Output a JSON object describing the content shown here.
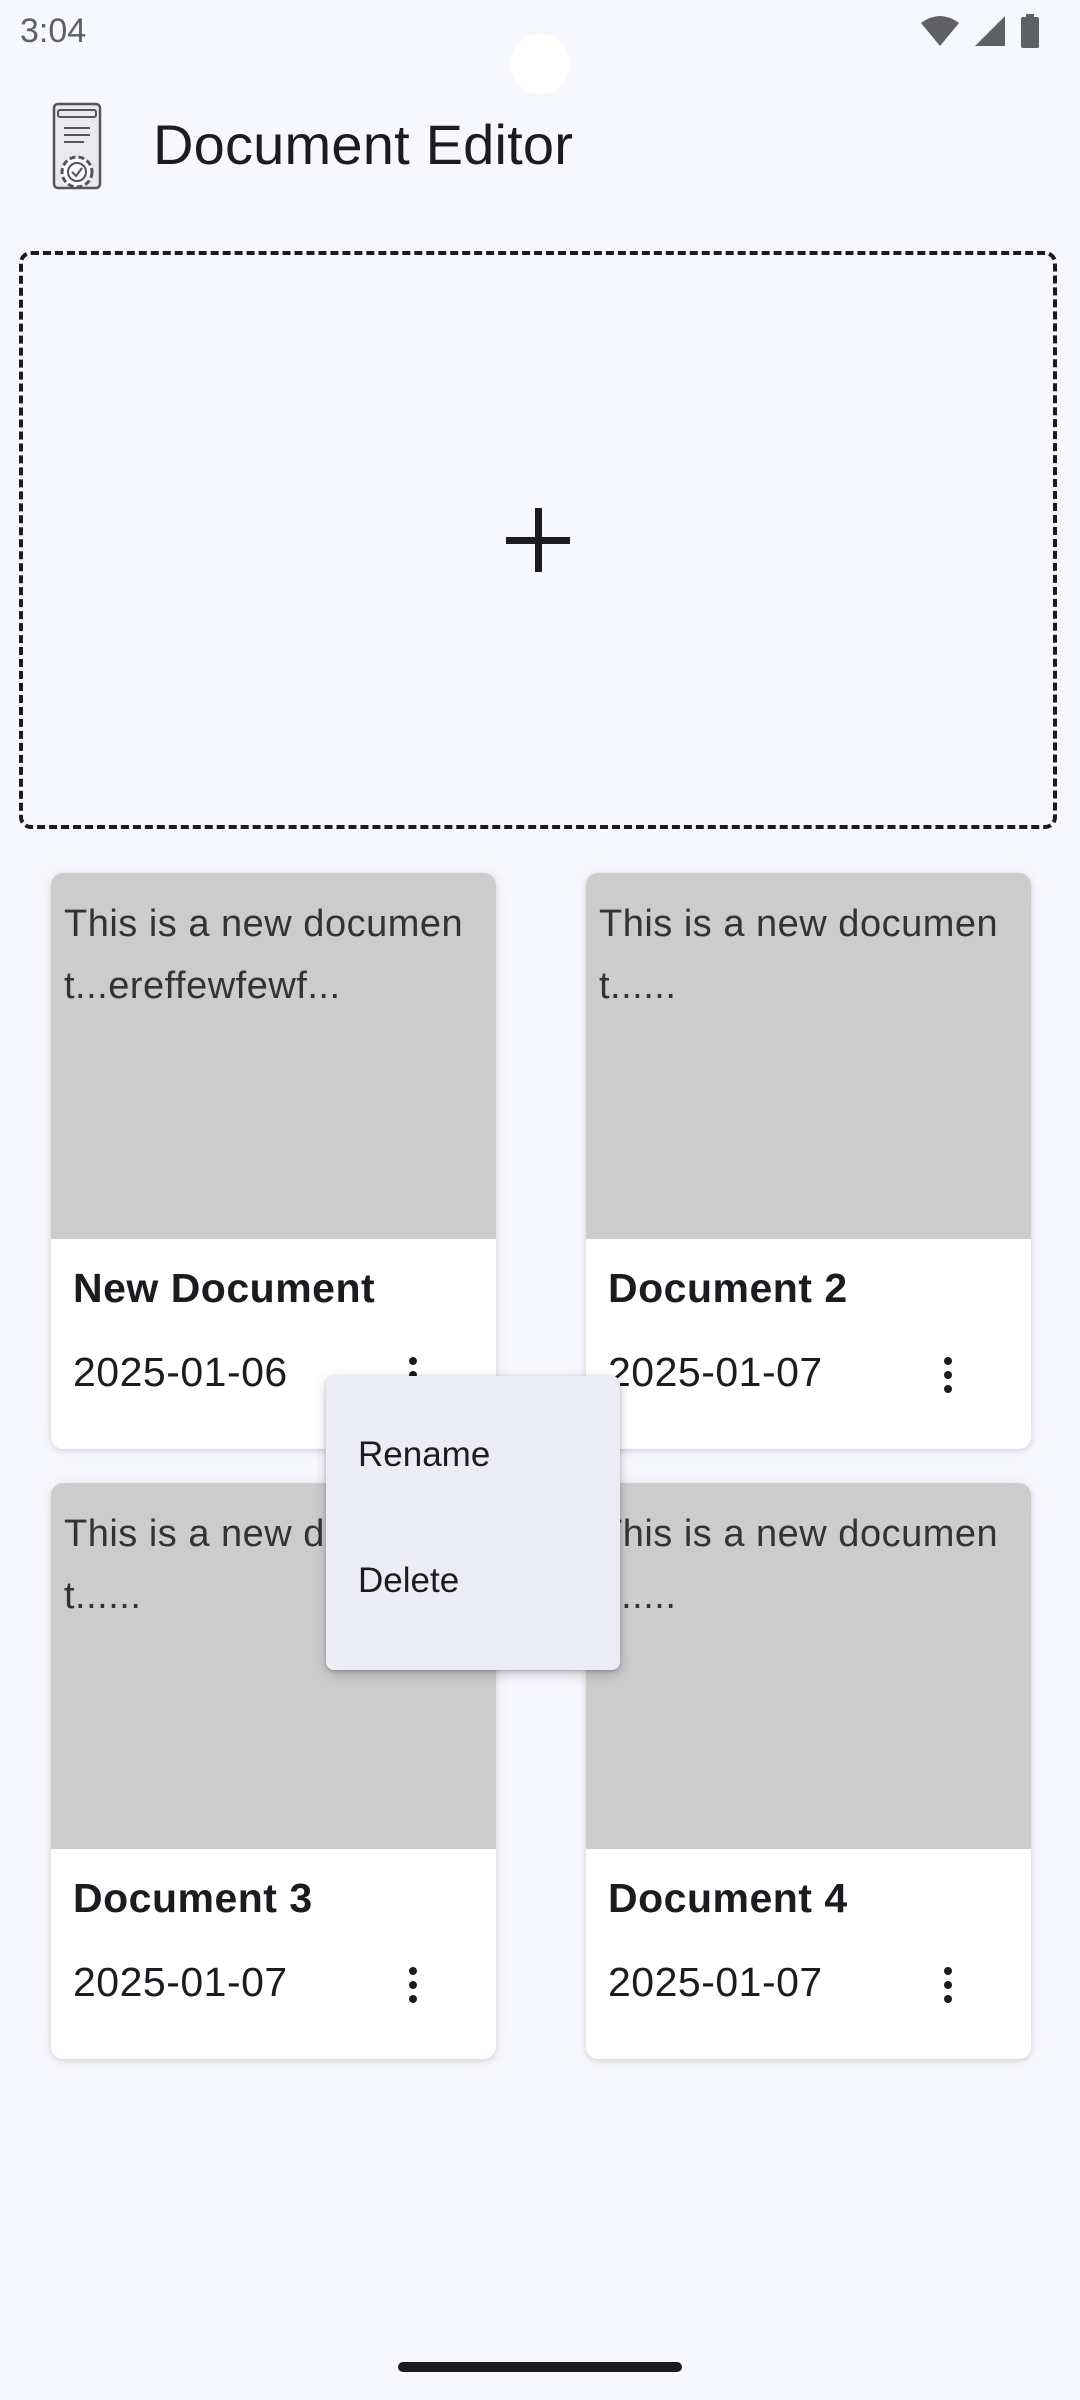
{
  "status_bar": {
    "time": "3:04",
    "icons": [
      "wifi-icon",
      "signal-icon",
      "battery-icon"
    ]
  },
  "app_bar": {
    "title": "Document Editor",
    "logo": "document-settings-icon"
  },
  "new_document": {
    "icon": "plus-icon"
  },
  "documents": [
    {
      "preview": "This is a new document...ereffewfewf...",
      "title": "New Document",
      "date": "2025-01-06"
    },
    {
      "preview": "This is a new document......",
      "title": "Document 2",
      "date": "2025-01-07"
    },
    {
      "preview": "This is a new document......",
      "title": "Document 3",
      "date": "2025-01-07"
    },
    {
      "preview": "This is a new document......",
      "title": "Document 4",
      "date": "2025-01-07"
    }
  ],
  "context_menu": {
    "items": [
      "Rename",
      "Delete"
    ]
  },
  "colors": {
    "background": "#f7f8fd",
    "preview": "#cccccc",
    "menu": "#ebecf6",
    "text": "#1c1b1f"
  }
}
